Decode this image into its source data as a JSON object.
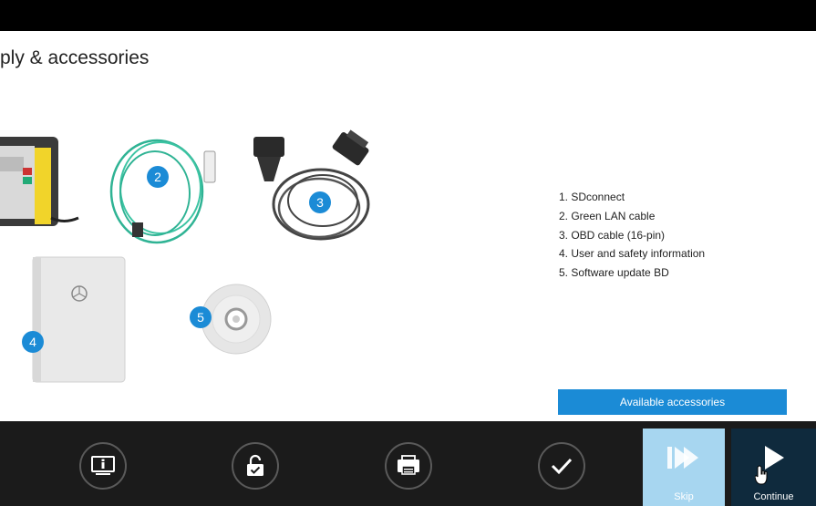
{
  "header": {
    "title": "ply & accessories"
  },
  "illustration": {
    "badges": [
      "2",
      "3",
      "4",
      "5"
    ],
    "badge_color": "#1b8bd6"
  },
  "items_list": [
    "1. SDconnect",
    "2. Green LAN cable",
    "3. OBD cable (16-pin)",
    "4. User and safety information",
    "5. Software update BD"
  ],
  "accessories_button": {
    "label": "Available accessories",
    "color": "#1b8bd6"
  },
  "bottom_nav": {
    "icons": [
      "info-screen-icon",
      "unlock-icon",
      "printer-icon",
      "checkmark-icon"
    ],
    "skip_label": "Skip",
    "continue_label": "Continue",
    "skip_color": "#a7d6f0",
    "continue_color": "#0f2a3d"
  }
}
